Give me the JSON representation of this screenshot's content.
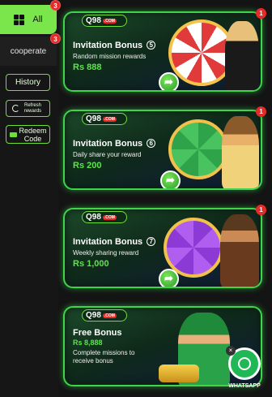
{
  "sidebar": {
    "all": {
      "label": "All",
      "badge": "3"
    },
    "cooperate": {
      "label": "cooperate",
      "badge": "3"
    },
    "history_label": "History",
    "refresh_label": "Refresh rewards",
    "redeem_label": "Redeem Code"
  },
  "brand": {
    "name": "Q98",
    "suffix": ".COM"
  },
  "cards": [
    {
      "title": "Invitation Bonus",
      "number": "5",
      "subtitle": "Random mission rewards",
      "amount": "Rs 888",
      "badge": "1"
    },
    {
      "title": "Invitation Bonus",
      "number": "6",
      "subtitle": "Daily share your reward",
      "amount": "Rs 200",
      "badge": "1"
    },
    {
      "title": "Invitation Bonus",
      "number": "7",
      "subtitle": "Weekly sharing reward",
      "amount": "Rs 1,000",
      "badge": "1"
    },
    {
      "title": "Free Bonus",
      "amount": "Rs 8,888",
      "description": "Complete missions to receive bonus"
    }
  ],
  "whatsapp": {
    "label": "WHATSAPP",
    "close": "×"
  },
  "colors": {
    "accent": "#6fe03a",
    "badge": "#e52a2a",
    "amount": "#5ee34d"
  }
}
